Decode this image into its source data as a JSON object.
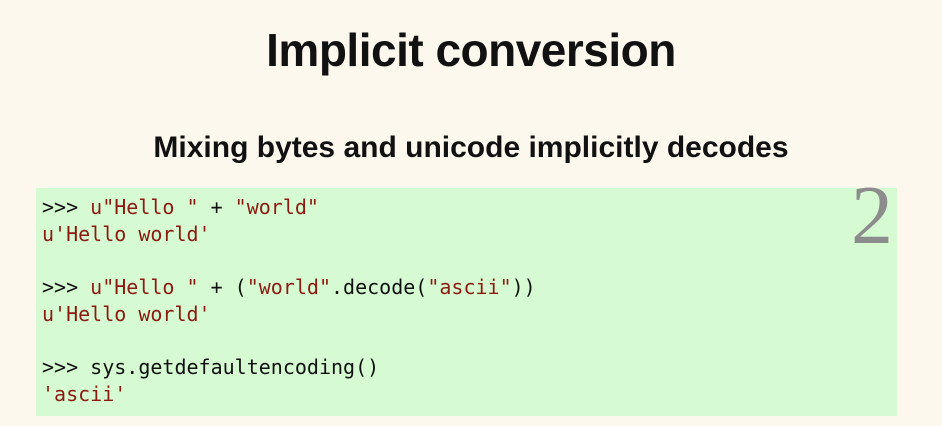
{
  "slide": {
    "title": "Implicit conversion",
    "subtitle": "Mixing bytes and unicode implicitly decodes",
    "page_number": "2"
  },
  "code": {
    "block1": {
      "prompt": ">>> ",
      "str1": "u\"Hello \"",
      "op": " + ",
      "str2": "\"world\"",
      "output": "u'Hello world'"
    },
    "block2": {
      "prompt": ">>> ",
      "str1": "u\"Hello \"",
      "op": " + (",
      "str2": "\"world\"",
      "method": ".decode(",
      "str3": "\"ascii\"",
      "close": "))",
      "output": "u'Hello world'"
    },
    "block3": {
      "prompt": ">>> ",
      "call": "sys.getdefaultencoding()",
      "output": "'ascii'"
    }
  },
  "colors": {
    "background": "#fdf8ee",
    "code_background": "#d6fbd3",
    "string": "#8b1a12",
    "page_number": "#8c8c8c"
  }
}
